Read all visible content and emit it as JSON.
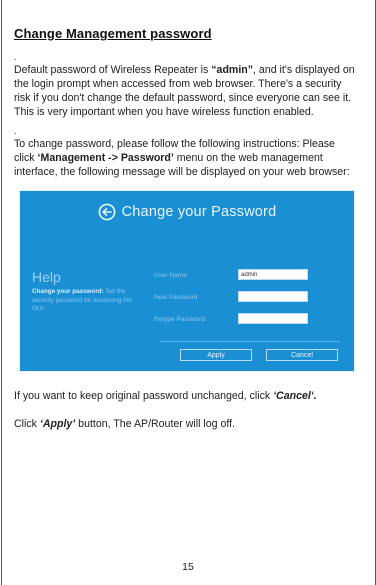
{
  "section_title": "Change Management password",
  "para1": {
    "pre": "Default password of Wireless Repeater is ",
    "highlight": "“admin”",
    "post": ", and it's displayed on the login prompt when accessed from web browser. There's a security risk if you don't change the default password, since everyone can see it. This is very important when you have wireless function enabled."
  },
  "para2": {
    "pre": "To change password, please follow the following instructions: Please click ",
    "menu": "‘Management -> Password’",
    "post": " menu on the web management interface, the following message will be displayed on your web browser:"
  },
  "screenshot": {
    "title": "Change your Password",
    "help_heading": "Help",
    "help_bold": "Change your password:",
    "help_text": "Set the security password for accessing the GUI.",
    "user_name_label": "User Name",
    "user_name_value": "admin",
    "new_password_label": "New Password",
    "new_password_value": "",
    "retype_password_label": "Retype Password",
    "retype_password_value": "",
    "apply_label": "Apply",
    "cancel_label": "Cancel",
    "colors": {
      "background": "#1b8fd4",
      "label": "#8cc7ee"
    },
    "icon": "back-arrow-circle-icon"
  },
  "para3": {
    "pre": "If you want to keep original password unchanged, click ",
    "em": "‘Cancel‘.",
    "post": ""
  },
  "para4": {
    "pre": "Click ",
    "em": "‘Apply’",
    "post": " button, The AP/Router will log off."
  },
  "page_number": "15"
}
